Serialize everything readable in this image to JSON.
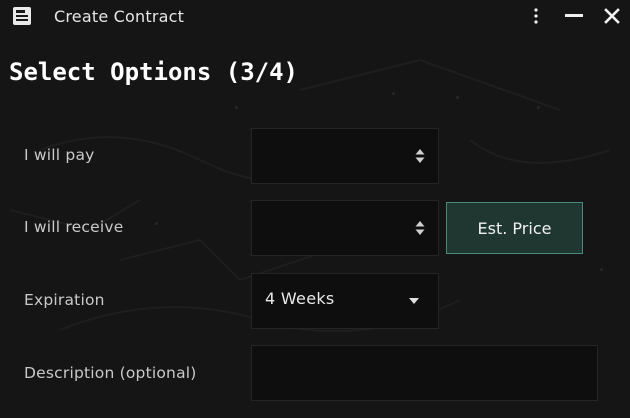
{
  "window": {
    "title": "Create Contract",
    "icon": "contract-app-icon",
    "controls": [
      "menu-dots-icon",
      "minimize-icon",
      "close-icon"
    ]
  },
  "heading": "Select Options (3/4)",
  "form": {
    "pay": {
      "label": "I will pay",
      "value": "",
      "control": "stepper"
    },
    "receive": {
      "label": "I will receive",
      "value": "",
      "control": "stepper"
    },
    "est_price_label": "Est. Price",
    "expiration": {
      "label": "Expiration",
      "value": "4 Weeks",
      "control": "dropdown"
    },
    "description": {
      "label": "Description (optional)",
      "value": ""
    }
  },
  "colors": {
    "background": "#151515",
    "field": "#0e0e0e",
    "accent_border": "#4b8a79",
    "accent_fill": "#1f3631",
    "text": "#d8d8d8"
  }
}
